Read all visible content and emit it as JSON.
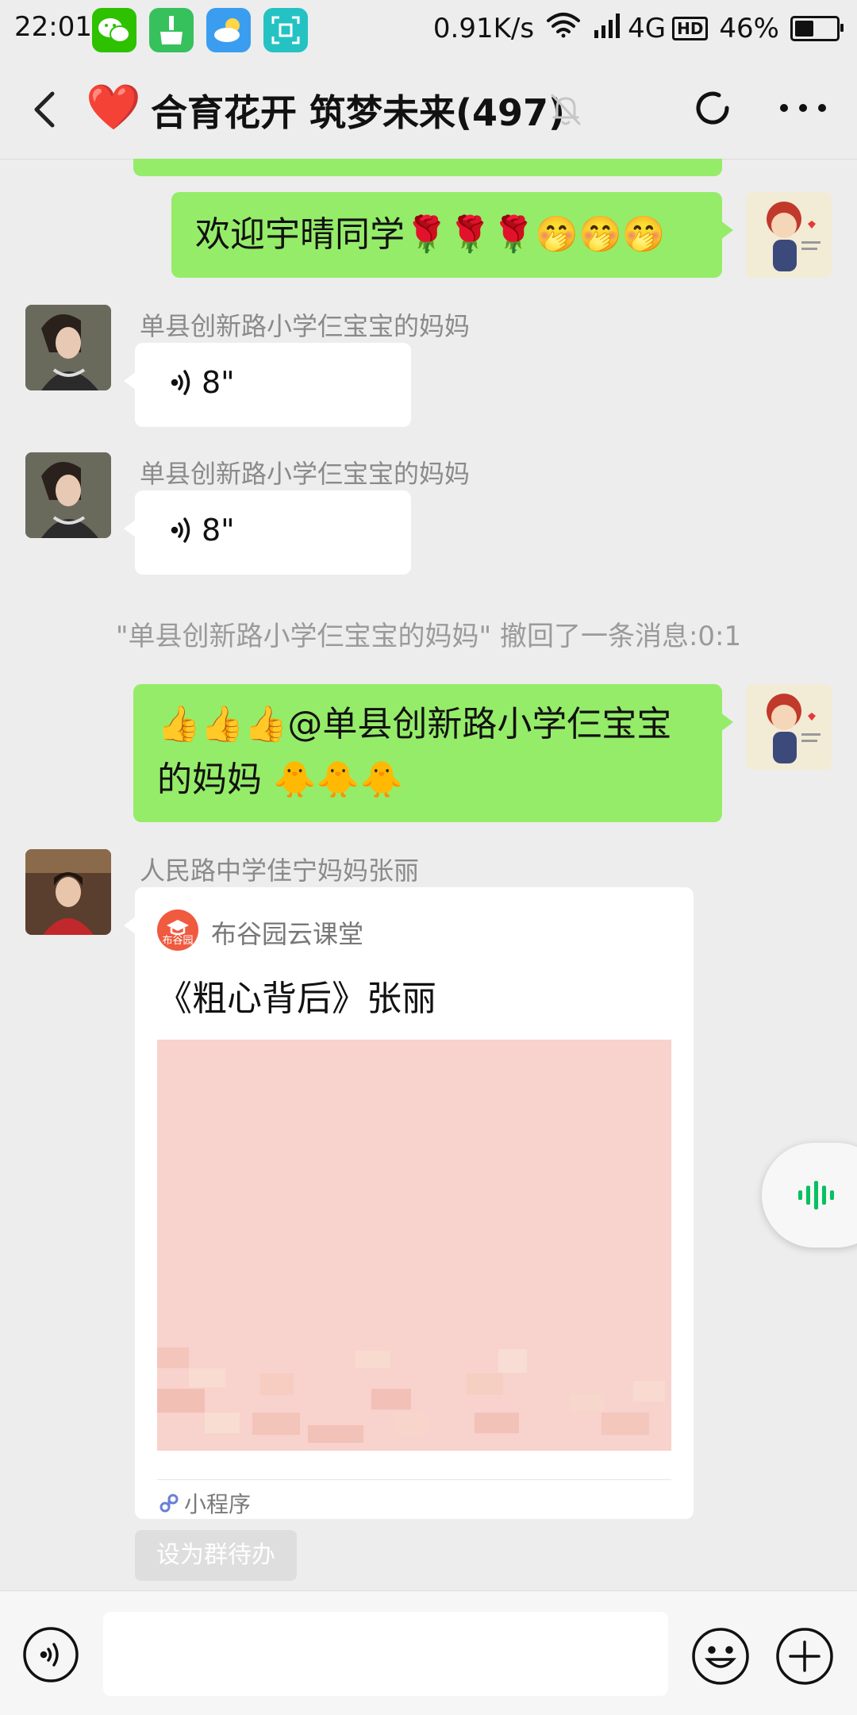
{
  "status_bar": {
    "time": "22:01",
    "net_speed": "0.91K/s",
    "network": "4G",
    "hd": "HD",
    "battery": "46%",
    "battery_level": 0.46,
    "app_icons": [
      "wechat-icon",
      "cleaner-icon",
      "weather-icon",
      "scan-icon"
    ]
  },
  "header": {
    "title": "合育花开 筑梦未来(497)",
    "title_emoji": "❤️"
  },
  "messages": [
    {
      "type": "text",
      "side": "self",
      "text": "欢迎宇晴同学🌹🌹🌹🤭🤭🤭"
    },
    {
      "type": "voice",
      "side": "other",
      "sender": "单县创新路小学仨宝宝的妈妈",
      "duration": "8\""
    },
    {
      "type": "voice",
      "side": "other",
      "sender": "单县创新路小学仨宝宝的妈妈",
      "duration": "8\""
    },
    {
      "type": "system",
      "text": "\"单县创新路小学仨宝宝的妈妈\" 撤回了一条消息:0:1"
    },
    {
      "type": "text",
      "side": "self",
      "text": "👍👍👍@单县创新路小学仨宝宝的妈妈 🐥🐥🐥"
    },
    {
      "type": "miniprogram",
      "side": "other",
      "sender": "人民路中学佳宁妈妈张丽",
      "app_name": "布谷园云课堂",
      "logo_text": "布谷园",
      "title": "《粗心背后》张丽",
      "footer": "小程序"
    }
  ],
  "set_todo_label": "设为群待办",
  "input": {
    "placeholder": "",
    "value": ""
  },
  "colors": {
    "background": "#ededed",
    "self_bubble": "#95ec69",
    "other_bubble": "#ffffff",
    "accent_green": "#07c160"
  }
}
